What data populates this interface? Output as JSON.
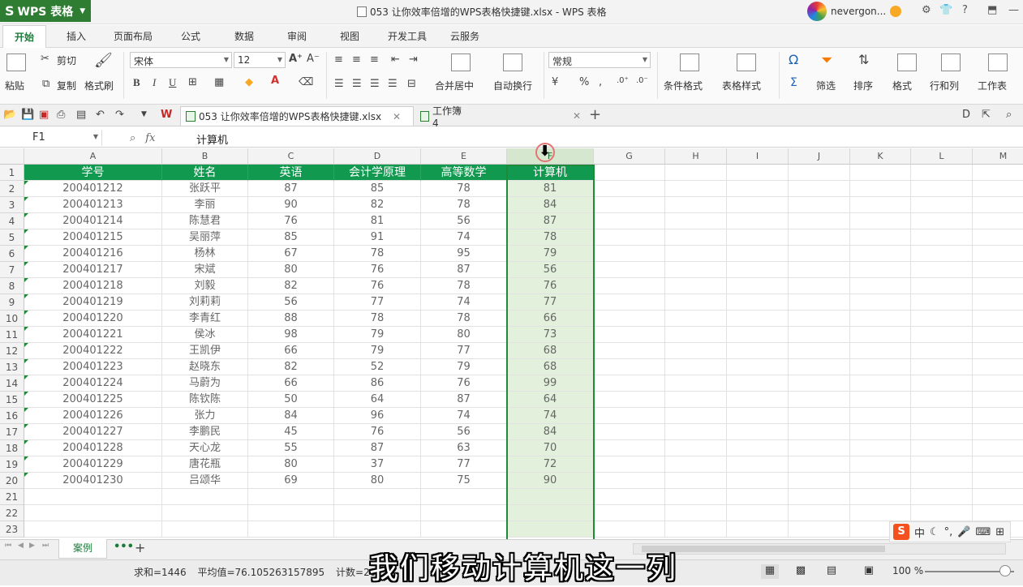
{
  "app": {
    "badge": "WPS 表格",
    "window_title": "053 让你效率倍增的WPS表格快捷键.xlsx - WPS 表格",
    "user": "nevergon..."
  },
  "menu_tabs": [
    "开始",
    "插入",
    "页面布局",
    "公式",
    "数据",
    "审阅",
    "视图",
    "开发工具",
    "云服务"
  ],
  "ribbon": {
    "paste": "粘贴",
    "cut": "剪切",
    "copy": "复制",
    "format_painter": "格式刷",
    "font_name": "宋体",
    "font_size": "12",
    "bold": "B",
    "italic": "I",
    "underline": "U",
    "merge_center": "合并居中",
    "wrap_text": "自动换行",
    "number_format": "常规",
    "percent": "%",
    "comma": ",",
    "conditional_format": "条件格式",
    "table_style": "表格样式",
    "sum": "Σ",
    "symbol": "Ω",
    "filter": "筛选",
    "sort": "排序",
    "format": "格式",
    "row_col": "行和列",
    "worksheet": "工作表"
  },
  "doc_tabs": [
    {
      "label": "053 让你效率倍增的WPS表格快捷键.xlsx",
      "active": true
    },
    {
      "label": "工作簿4",
      "active": false
    }
  ],
  "formula_bar": {
    "cell_ref": "F1",
    "fx": "fx",
    "content": "计算机"
  },
  "columns": [
    "A",
    "B",
    "C",
    "D",
    "E",
    "F",
    "G",
    "H",
    "I",
    "J",
    "K",
    "L",
    "M"
  ],
  "headers": [
    "学号",
    "姓名",
    "英语",
    "会计学原理",
    "高等数学",
    "计算机"
  ],
  "rows": [
    [
      "200401212",
      "张跃平",
      "87",
      "85",
      "78",
      "81"
    ],
    [
      "200401213",
      "李丽",
      "90",
      "82",
      "78",
      "84"
    ],
    [
      "200401214",
      "陈慧君",
      "76",
      "81",
      "56",
      "87"
    ],
    [
      "200401215",
      "吴丽萍",
      "85",
      "91",
      "74",
      "78"
    ],
    [
      "200401216",
      "杨林",
      "67",
      "78",
      "95",
      "79"
    ],
    [
      "200401217",
      "宋斌",
      "80",
      "76",
      "87",
      "56"
    ],
    [
      "200401218",
      "刘毅",
      "82",
      "76",
      "78",
      "76"
    ],
    [
      "200401219",
      "刘莉莉",
      "56",
      "77",
      "74",
      "77"
    ],
    [
      "200401220",
      "李青红",
      "88",
      "78",
      "78",
      "66"
    ],
    [
      "200401221",
      "侯冰",
      "98",
      "79",
      "80",
      "73"
    ],
    [
      "200401222",
      "王凯伊",
      "66",
      "79",
      "77",
      "68"
    ],
    [
      "200401223",
      "赵晓东",
      "82",
      "52",
      "79",
      "68"
    ],
    [
      "200401224",
      "马蔚为",
      "66",
      "86",
      "76",
      "99"
    ],
    [
      "200401225",
      "陈钦陈",
      "50",
      "64",
      "87",
      "64"
    ],
    [
      "200401226",
      "张力",
      "84",
      "96",
      "74",
      "74"
    ],
    [
      "200401227",
      "李鹏民",
      "45",
      "76",
      "56",
      "84"
    ],
    [
      "200401228",
      "天心龙",
      "55",
      "87",
      "63",
      "70"
    ],
    [
      "200401229",
      "唐花瓶",
      "80",
      "37",
      "77",
      "72"
    ],
    [
      "200401230",
      "吕颂华",
      "69",
      "80",
      "75",
      "90"
    ]
  ],
  "row_numbers": [
    "1",
    "2",
    "3",
    "4",
    "5",
    "6",
    "7",
    "8",
    "9",
    "10",
    "11",
    "12",
    "13",
    "14",
    "15",
    "16",
    "17",
    "18",
    "19",
    "20",
    "21",
    "22",
    "23"
  ],
  "sheet": {
    "active_tab": "案例",
    "add": "+"
  },
  "status": {
    "sum": "求和=1446",
    "average": "平均值=76.105263157895",
    "count": "计数=20",
    "zoom": "100 %"
  },
  "subtitle": "我们移动计算机这一列",
  "ime": {
    "logo": "S",
    "lang": "中"
  },
  "colors": {
    "header_green": "#119a4f",
    "selection_green": "#1e8a3a",
    "selected_fill": "#e3f0dc"
  }
}
